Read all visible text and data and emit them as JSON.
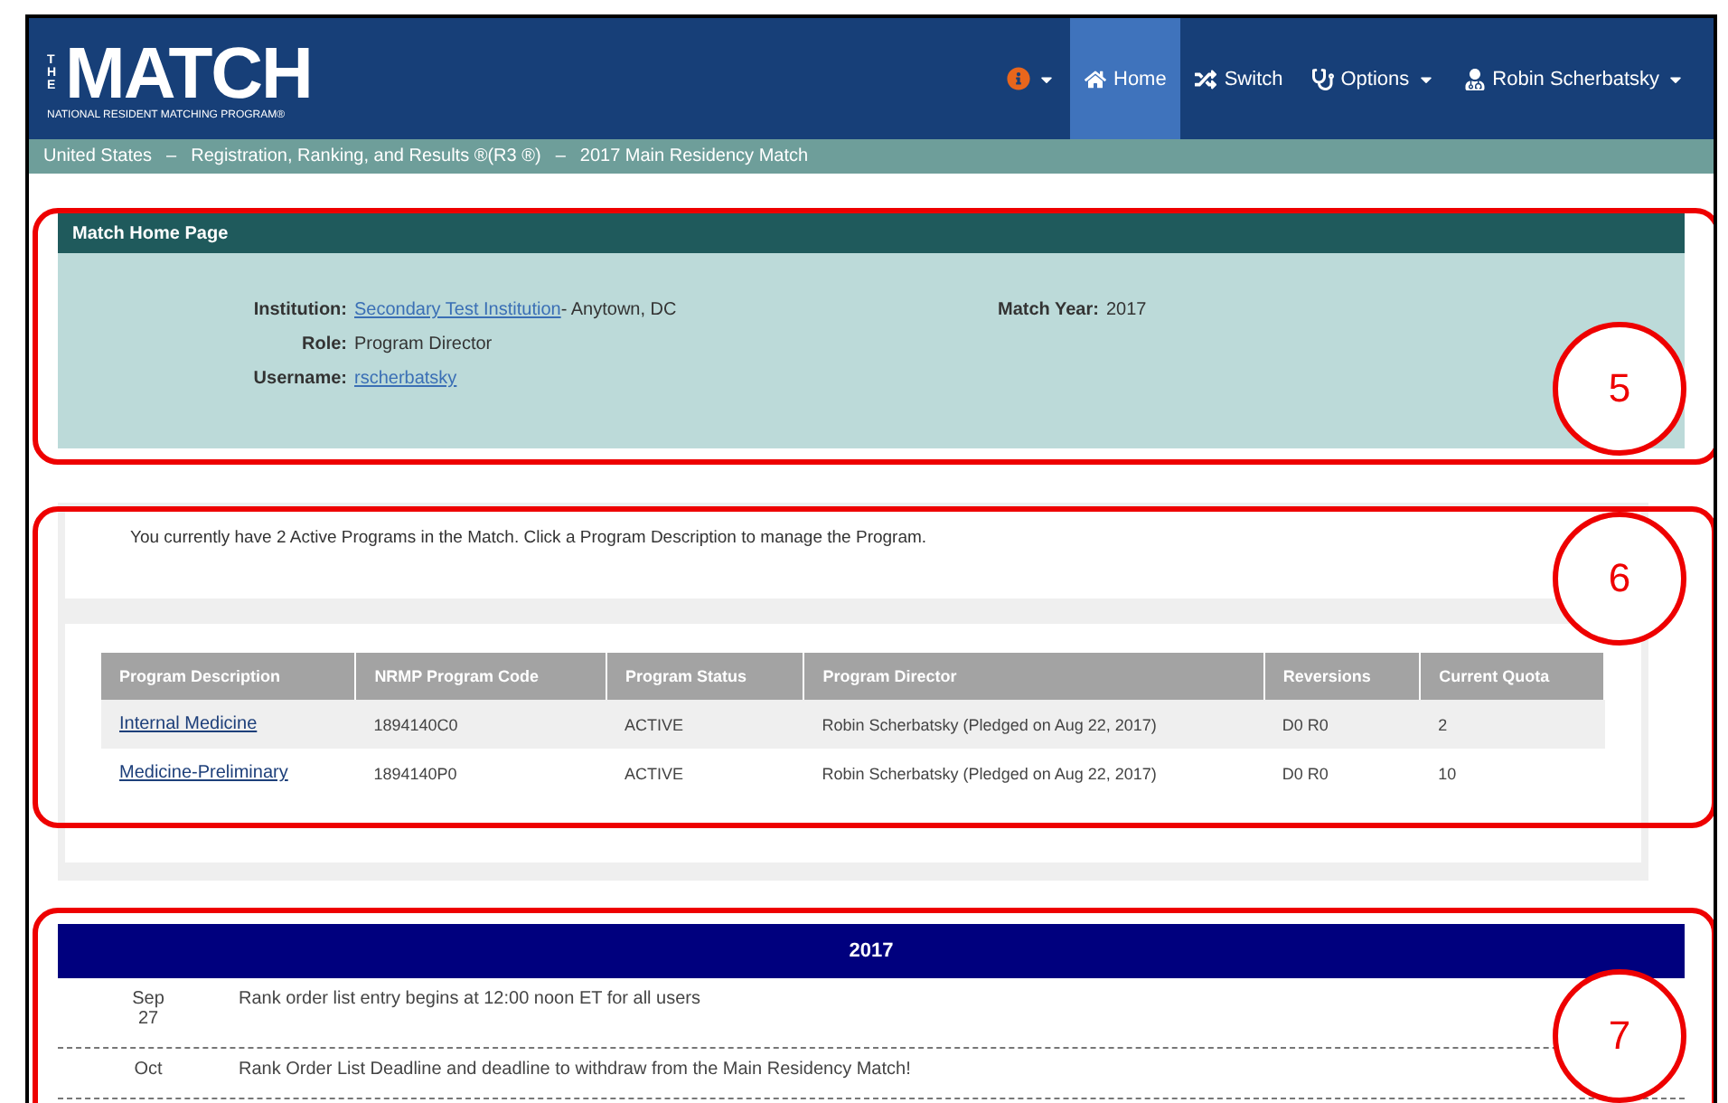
{
  "logo": {
    "top": "THE",
    "main": "MATCH",
    "sub": "NATIONAL RESIDENT MATCHING PROGRAM®"
  },
  "nav": [
    {
      "kind": "info",
      "caret": true,
      "selected": false
    },
    {
      "kind": "home",
      "label": "Home",
      "caret": false,
      "selected": true
    },
    {
      "kind": "switch",
      "label": "Switch",
      "caret": false,
      "selected": false
    },
    {
      "kind": "options",
      "label": "Options",
      "caret": true,
      "selected": false
    },
    {
      "kind": "user",
      "label": "Robin Scherbatsky",
      "caret": true,
      "selected": false
    }
  ],
  "breadcrumb": {
    "items": [
      "United States",
      "Registration, Ranking, and Results ®(R3 ®)",
      "2017 Main Residency Match"
    ],
    "separator": "–"
  },
  "home_panel": {
    "title": "Match Home Page",
    "fields": [
      {
        "label": "Institution:",
        "link": "Secondary Test Institution",
        "value": " - Anytown, DC"
      },
      {
        "label": "Role:",
        "value": "Program Director"
      },
      {
        "label": "Username:",
        "link": "rscherbatsky"
      }
    ],
    "match_year": {
      "label": "Match Year:",
      "value": "2017"
    }
  },
  "programs": {
    "intro": "You currently have 2 Active Programs in the Match. Click a Program Description to manage the Program.",
    "columns": [
      "Program Description",
      "NRMP Program Code",
      "Program Status",
      "Program Director",
      "Reversions",
      "Current Quota"
    ],
    "rows": [
      [
        "Internal Medicine",
        "1894140C0",
        "ACTIVE",
        "Robin Scherbatsky (Pledged on Aug 22, 2017)",
        "D0 R0",
        "2"
      ],
      [
        "Medicine-Preliminary",
        "1894140P0",
        "ACTIVE",
        "Robin Scherbatsky (Pledged on Aug 22, 2017)",
        "D0 R0",
        "10"
      ]
    ]
  },
  "calendar": {
    "year": "2017",
    "events": [
      {
        "month": "Sep",
        "day": "27",
        "text": "Rank order list entry begins at 12:00 noon ET for all users"
      },
      {
        "month": "Oct",
        "text": "Rank Order List Deadline and deadline to withdraw from the Main Residency Match!"
      }
    ]
  },
  "callouts": [
    "5",
    "6",
    "7"
  ]
}
